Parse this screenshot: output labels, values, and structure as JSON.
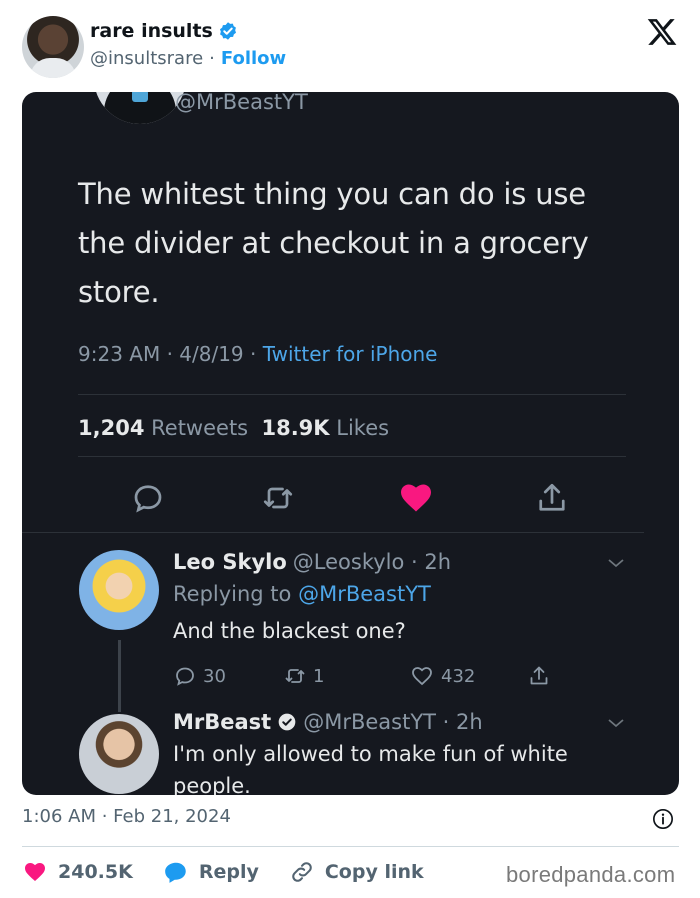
{
  "embed": {
    "author_name": "rare insults",
    "author_handle": "@insultsrare",
    "separator": "·",
    "follow_label": "Follow"
  },
  "screenshot": {
    "top_handle": "@MrBeastYT",
    "tweet_text": "The whitest thing you can do is use the divider at checkout in a grocery store.",
    "meta_time": "9:23 AM · 4/8/19 · ",
    "meta_source": "Twitter for iPhone",
    "retweets_count": "1,204",
    "retweets_label": "Retweets",
    "likes_count": "18.9K",
    "likes_label": "Likes",
    "replies": [
      {
        "name": "Leo Skylo",
        "handle_time": "@Leoskylo · 2h",
        "replying_prefix": "Replying to ",
        "replying_mention": "@MrBeastYT",
        "text": "And the blackest one?",
        "reply_count": "30",
        "retweet_count": "1",
        "like_count": "432"
      },
      {
        "name": "MrBeast",
        "handle_time": "@MrBeastYT · 2h",
        "text_line1": "I'm only allowed to make fun of white",
        "text_line2": "people."
      }
    ]
  },
  "footer": {
    "timestamp": "1:06 AM · Feb 21, 2024",
    "likes": "240.5K",
    "reply_label": "Reply",
    "copy_link_label": "Copy link"
  },
  "watermark": "boredpanda.com",
  "colors": {
    "accent": "#1d9bf0",
    "heart": "#f91880",
    "card_bg": "#15181f"
  }
}
